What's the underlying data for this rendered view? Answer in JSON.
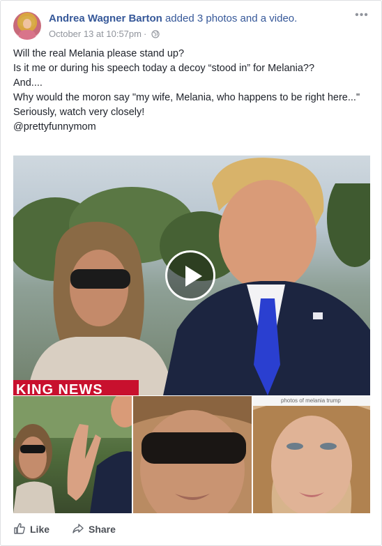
{
  "post": {
    "author": "Andrea Wagner Barton",
    "action": "added 3 photos and a video.",
    "timestamp": "October 13 at 10:57pm",
    "separator": "·",
    "privacy_icon": "globe-icon",
    "more_icon": "more-dots-icon",
    "more_label": "•••",
    "text_lines": [
      "Will the real Melania please stand up?",
      "Is it me or during his speech today a decoy “stood in” for Melania??",
      "And....",
      "Why would the moron say \"my wife, Melania, who happens to be right here...\"",
      "Seriously, watch very closely!",
      "@prettyfunnymom"
    ]
  },
  "media": {
    "main_overlay_text": "KING NEWS",
    "play_icon": "play-icon",
    "thumb3_search_text": "photos of melania trump"
  },
  "actions": {
    "like_label": "Like",
    "share_label": "Share"
  },
  "colors": {
    "link_blue": "#365899",
    "meta_gray": "#90949c",
    "banner_red": "#c8102e"
  }
}
